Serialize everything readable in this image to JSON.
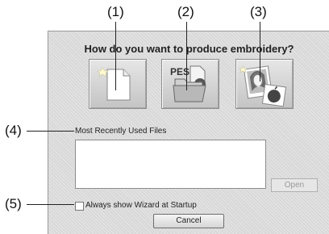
{
  "callouts": [
    "(1)",
    "(2)",
    "(3)",
    "(4)",
    "(5)"
  ],
  "dialog": {
    "question": "How do you want to produce embroidery?",
    "buttons": [
      {
        "name": "new-design",
        "icon": "blank-page-icon"
      },
      {
        "name": "open-pes",
        "icon": "pes-folder-icon",
        "icon_text": "PES"
      },
      {
        "name": "photo-stitch",
        "icon": "photo-apple-icon"
      }
    ],
    "mru_label": "Most Recently Used Files",
    "mru_files": [],
    "open_label": "Open",
    "checkbox": {
      "label": "Always show Wizard at Startup",
      "checked": false
    },
    "cancel_label": "Cancel"
  }
}
